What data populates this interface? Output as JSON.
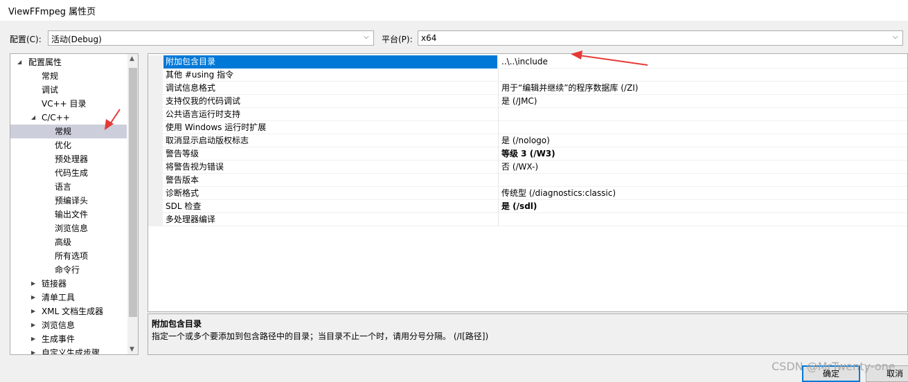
{
  "window": {
    "title": "ViewFFmpeg 属性页"
  },
  "config": {
    "label": "配置(C):",
    "value": "活动(Debug)"
  },
  "platform": {
    "label": "平台(P):",
    "value": "x64"
  },
  "tree": {
    "items": [
      {
        "label": "配置属性",
        "expanded": true
      },
      {
        "label": "常规"
      },
      {
        "label": "调试"
      },
      {
        "label": "VC++ 目录"
      },
      {
        "label": "C/C++",
        "expanded": true
      },
      {
        "label": "常规",
        "selected": true
      },
      {
        "label": "优化"
      },
      {
        "label": "预处理器"
      },
      {
        "label": "代码生成"
      },
      {
        "label": "语言"
      },
      {
        "label": "预编译头"
      },
      {
        "label": "输出文件"
      },
      {
        "label": "浏览信息"
      },
      {
        "label": "高级"
      },
      {
        "label": "所有选项"
      },
      {
        "label": "命令行"
      },
      {
        "label": "链接器",
        "expanded": false
      },
      {
        "label": "清单工具",
        "expanded": false
      },
      {
        "label": "XML 文档生成器",
        "expanded": false
      },
      {
        "label": "浏览信息",
        "expanded": false
      },
      {
        "label": "生成事件",
        "expanded": false
      },
      {
        "label": "自定义生成步骤",
        "expanded": false
      }
    ]
  },
  "properties": [
    {
      "name": "附加包含目录",
      "value": "..\\..\\include",
      "selected": true
    },
    {
      "name": "其他 #using 指令",
      "value": ""
    },
    {
      "name": "调试信息格式",
      "value": "用于“编辑并继续”的程序数据库 (/ZI)"
    },
    {
      "name": "支持仅我的代码调试",
      "value": "是 (/JMC)"
    },
    {
      "name": "公共语言运行时支持",
      "value": ""
    },
    {
      "name": "使用 Windows 运行时扩展",
      "value": ""
    },
    {
      "name": "取消显示启动版权标志",
      "value": "是 (/nologo)"
    },
    {
      "name": "警告等级",
      "value": "等级 3 (/W3)",
      "bold": true
    },
    {
      "name": "将警告视为错误",
      "value": "否 (/WX-)"
    },
    {
      "name": "警告版本",
      "value": ""
    },
    {
      "name": "诊断格式",
      "value": "传统型 (/diagnostics:classic)"
    },
    {
      "name": "SDL 检查",
      "value": "是 (/sdl)",
      "bold": true
    },
    {
      "name": "多处理器编译",
      "value": ""
    }
  ],
  "description": {
    "title": "附加包含目录",
    "text": "指定一个或多个要添加到包含路径中的目录；当目录不止一个时，请用分号分隔。      (/I[路径])"
  },
  "buttons": {
    "ok": "确定",
    "cancel": "取消"
  },
  "watermark": "CSDN @MrTwenty-one",
  "colors": {
    "selection": "#0078d7",
    "tree_selection": "#cccedb",
    "arrow": "#e53935"
  }
}
